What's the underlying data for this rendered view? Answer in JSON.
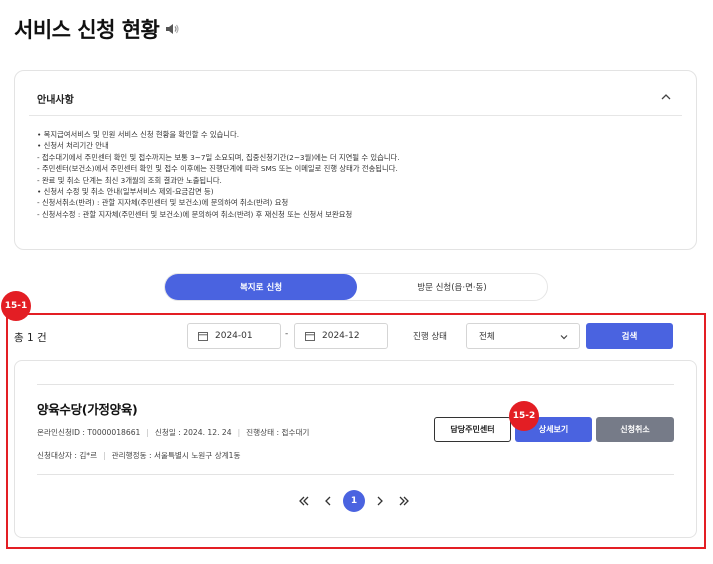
{
  "page": {
    "title": "서비스 신청 현황"
  },
  "notice": {
    "heading": "안내사항",
    "lines": [
      "• 복지급여서비스 및 민원 서비스 신청 현황을 확인할 수 있습니다.",
      "• 신청서 처리기간 안내",
      "  - 접수대기에서 주민센터 확인 및 접수까지는 보통 3~7일 소요되며, 집중신청기간(2~3월)에는 더 지연될 수 있습니다.",
      "  - 주민센터(보건소)에서 주민센터 확인 및 접수 이후에는 진행단계에 따라 SMS 또는 이메일로 진행 상태가 전송됩니다.",
      "  - 완료 및 취소 단계는 최신 3개월의 조회 결과만 노출됩니다.",
      "• 신청서 수정 및 취소 안내(일부서비스 제외-요금감면 등)",
      "  - 신청서취소(반려) : 관할 지자체(주민센터 및 보건소)에 문의하여 취소(반려) 요청",
      "  - 신청서수정 : 관할 지자체(주민센터 및 보건소)에 문의하여 취소(반려) 후 재신청 또는 신청서 보완요청"
    ]
  },
  "tabs": [
    {
      "label": "복지로 신청"
    },
    {
      "label": "방문 신청(읍·면·동)"
    }
  ],
  "badges": {
    "filter": "15-1",
    "detail": "15-2"
  },
  "filter": {
    "total_label": "총 1 건",
    "date_from": "2024-01",
    "date_separator": "-",
    "date_to": "2024-12",
    "status_label": "진행 상태",
    "status_value": "전체",
    "search_label": "검색"
  },
  "result": {
    "title": "양육수당(가정양육)",
    "online_id": "온라인신청ID : T0000018661",
    "apply_date": "신청일 : 2024. 12. 24",
    "progress": "진행상태 : 접수대기",
    "target": "신청대상자 : 김*르",
    "jurisdiction": "관리행정동 : 서울특별시 노원구 상계1동",
    "btn_center": "담당주민센터",
    "btn_detail": "상세보기",
    "btn_cancel": "신청취소"
  },
  "pager": {
    "current": "1"
  },
  "colors": {
    "primary": "#4a63e0",
    "highlight": "#e31e24",
    "cancel": "#767b88"
  }
}
